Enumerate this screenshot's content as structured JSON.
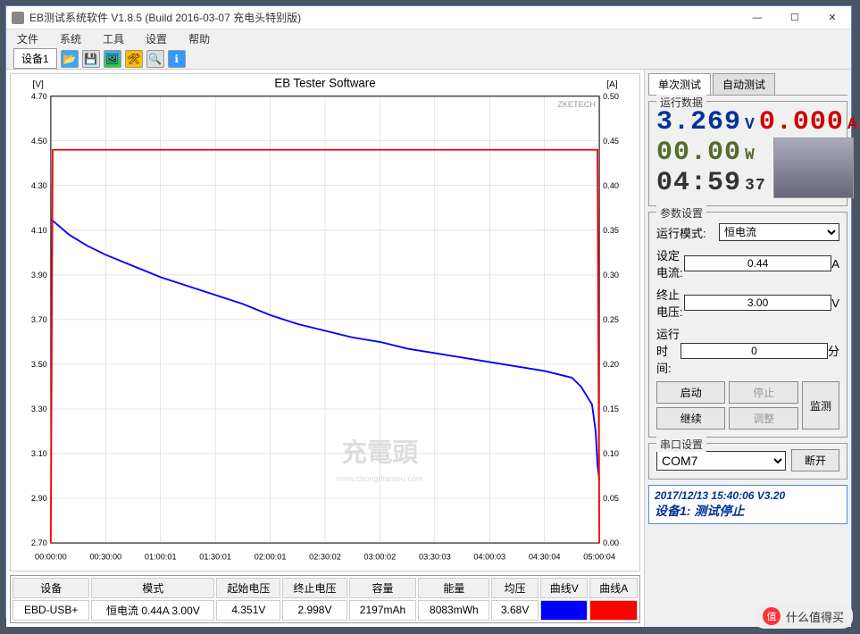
{
  "window": {
    "title": "EB测试系统软件 V1.8.5 (Build 2016-03-07 充电头特别版)"
  },
  "menu": {
    "file": "文件",
    "system": "系统",
    "tools": "工具",
    "settings": "设置",
    "help": "帮助"
  },
  "toolbar": {
    "device_tab": "设备1"
  },
  "chart_data": {
    "type": "line",
    "title": "EB Tester Software",
    "watermark_brand": "ZKETECH",
    "y_left_unit": "[V]",
    "y_right_unit": "[A]",
    "x_ticks": [
      "00:00:00",
      "00:30:00",
      "01:00:01",
      "01:30:01",
      "02:00:01",
      "02:30:02",
      "03:00:02",
      "03:30:03",
      "04:00:03",
      "04:30:04",
      "05:00:04"
    ],
    "y_left_ticks": [
      2.7,
      2.9,
      3.1,
      3.3,
      3.5,
      3.7,
      3.9,
      4.1,
      4.3,
      4.5,
      4.7
    ],
    "y_right_ticks": [
      0.0,
      0.05,
      0.1,
      0.15,
      0.2,
      0.25,
      0.3,
      0.35,
      0.4,
      0.45,
      0.5
    ],
    "series": [
      {
        "name": "曲线V",
        "color": "#0000ff",
        "axis": "left",
        "x_minutes": [
          0,
          10,
          20,
          30,
          45,
          60,
          75,
          90,
          105,
          120,
          135,
          150,
          165,
          180,
          195,
          210,
          225,
          240,
          255,
          270,
          285,
          290,
          296,
          298,
          299,
          300
        ],
        "values": [
          4.15,
          4.08,
          4.03,
          3.99,
          3.94,
          3.89,
          3.85,
          3.81,
          3.77,
          3.72,
          3.68,
          3.65,
          3.62,
          3.6,
          3.57,
          3.55,
          3.53,
          3.51,
          3.49,
          3.47,
          3.44,
          3.4,
          3.32,
          3.2,
          3.05,
          2.98
        ]
      },
      {
        "name": "曲线A",
        "color": "#ff0000",
        "axis": "right",
        "x_minutes": [
          0,
          1,
          2,
          298,
          299,
          300
        ],
        "values": [
          0.0,
          0.44,
          0.44,
          0.44,
          0.44,
          0.0
        ]
      }
    ],
    "center_watermark": "充電頭",
    "center_watermark_sub": "www.chongdiantou.com"
  },
  "table": {
    "headers": [
      "设备",
      "模式",
      "起始电压",
      "终止电压",
      "容量",
      "能量",
      "均压",
      "曲线V",
      "曲线A"
    ],
    "row": {
      "device": "EBD-USB+",
      "mode": "恒电流 0.44A 3.00V",
      "start_v": "4.351V",
      "end_v": "2.998V",
      "capacity": "2197mAh",
      "energy": "8083mWh",
      "avg_v": "3.68V"
    }
  },
  "side": {
    "tab_single": "单次测试",
    "tab_auto": "自动测试",
    "run_data_title": "运行数据",
    "voltage": "3.269",
    "v_unit": "V",
    "current": "0.000",
    "a_unit": "A",
    "power": "00.00",
    "w_unit": "W",
    "time_main": "04:59",
    "time_sec": "37",
    "params_title": "参数设置",
    "mode_label": "运行模式:",
    "mode_value": "恒电流",
    "set_current_label": "设定电流:",
    "set_current_value": "0.44",
    "set_current_unit": "A",
    "stop_v_label": "终止电压:",
    "stop_v_value": "3.00",
    "stop_v_unit": "V",
    "run_time_label": "运行时间:",
    "run_time_value": "0",
    "run_time_unit": "分",
    "btn_start": "启动",
    "btn_stop": "停止",
    "btn_continue": "继续",
    "btn_adjust": "调整",
    "btn_monitor": "监测",
    "port_title": "串口设置",
    "port_value": "COM7",
    "btn_disconnect": "断开",
    "status_line1": "2017/12/13 15:40:06  V3.20",
    "status_line2": "设备1: 测试停止"
  },
  "overlay_watermark": "什么值得买"
}
